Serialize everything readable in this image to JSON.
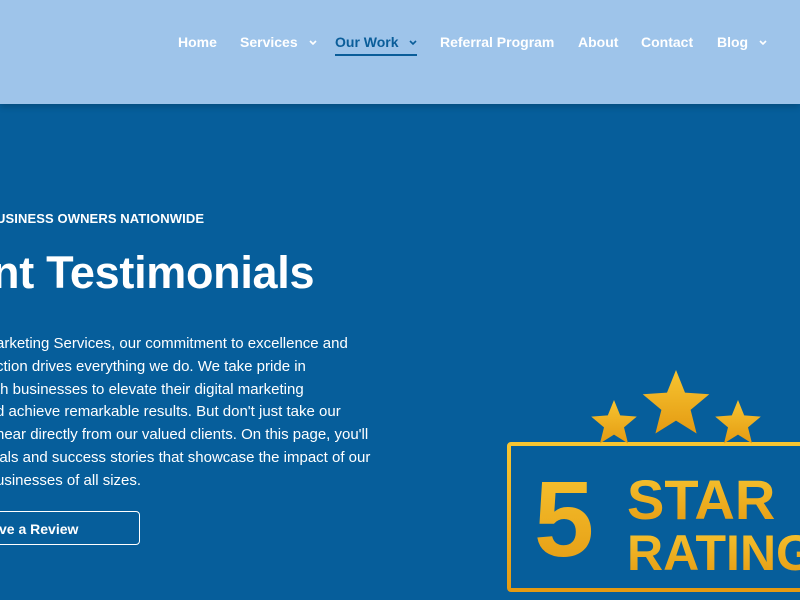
{
  "nav": {
    "items": [
      {
        "label": "Home",
        "has_dropdown": false,
        "active": false
      },
      {
        "label": "Services",
        "has_dropdown": true,
        "active": false
      },
      {
        "label": "Our Work",
        "has_dropdown": true,
        "active": true
      },
      {
        "label": "Referral Program",
        "has_dropdown": false,
        "active": false
      },
      {
        "label": "About",
        "has_dropdown": false,
        "active": false
      },
      {
        "label": "Contact",
        "has_dropdown": false,
        "active": false
      },
      {
        "label": "Blog",
        "has_dropdown": true,
        "active": false
      }
    ]
  },
  "hero": {
    "eyebrow": "USINESS OWNERS NATIONWIDE",
    "headline": "nt Testimonials",
    "body_lines": [
      "arketing Services, our commitment to excellence and",
      "ction drives everything we do. We take pride in",
      "th businesses to elevate their digital marketing",
      "d achieve remarkable results. But don't just take our",
      "hear directly from our valued clients. On this page, you'll",
      "ials and success stories that showcase the impact of our",
      "usinesses of all sizes."
    ],
    "cta_label": "ve a Review"
  },
  "badge": {
    "number": "5",
    "word_top": "STAR",
    "word_bottom": "RATING",
    "stars_shown": 3,
    "colors": {
      "gold_light": "#f7c531",
      "gold_dark": "#e49a12"
    }
  },
  "colors": {
    "header_bg": "#9ec4ea",
    "hero_bg": "#065e9b",
    "active_nav": "#0a5d99",
    "text": "#ffffff"
  }
}
